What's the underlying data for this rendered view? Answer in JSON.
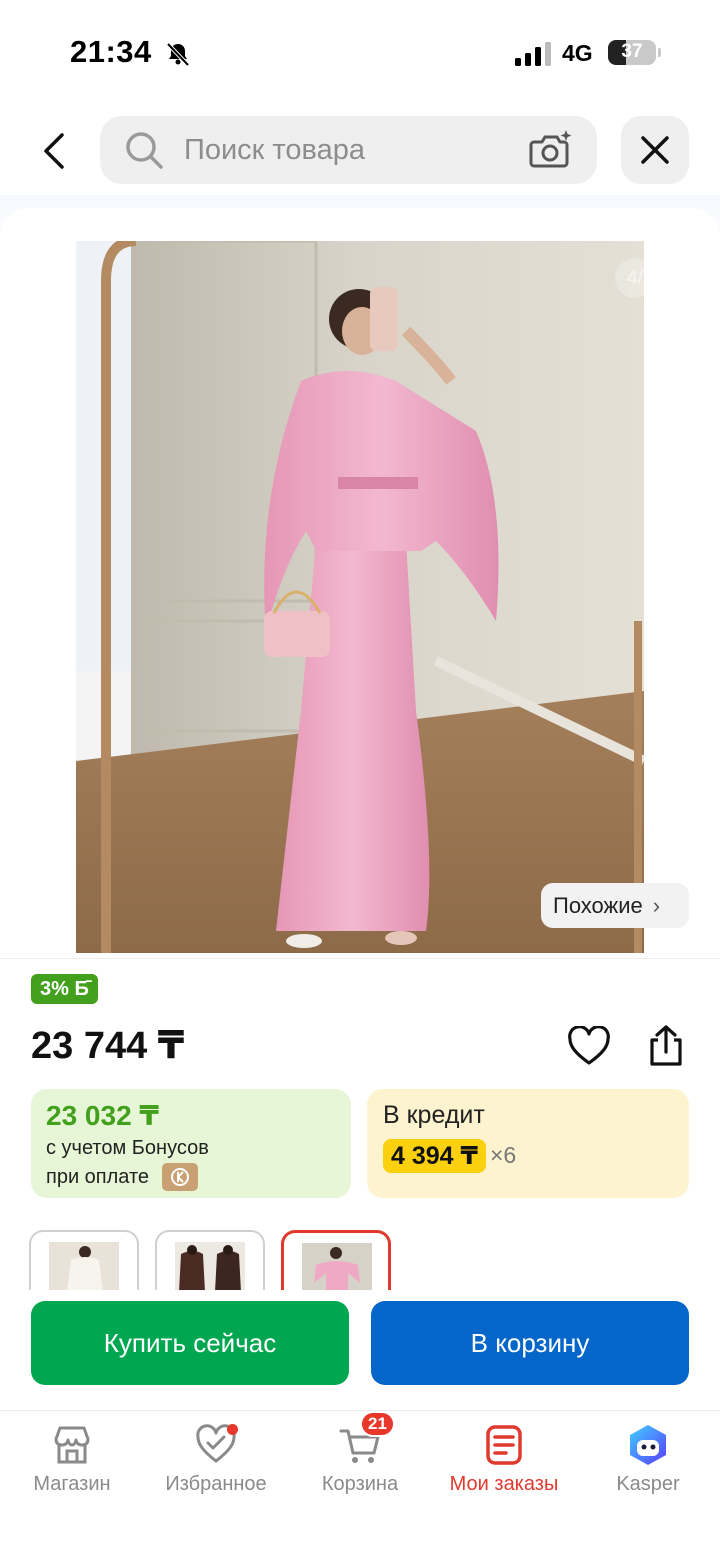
{
  "status_bar": {
    "time": "21:34",
    "network": "4G",
    "battery_level": "37"
  },
  "search": {
    "placeholder": "Поиск товара"
  },
  "product": {
    "image_counter": "4/",
    "similar_label": "Похожие",
    "bonus_badge": "3% Б̄",
    "price": "23 744 ₸",
    "bonus_price": "23 032 ₸",
    "bonus_line1": "с учетом Бонусов",
    "bonus_line2": "при оплате",
    "credit_title": "В кредит",
    "credit_amount": "4 394 ₸",
    "credit_multiplier": "×6",
    "thumbnails": [
      {
        "name": "white-outfit",
        "selected": false
      },
      {
        "name": "brown-outfit",
        "selected": false
      },
      {
        "name": "pink-outfit",
        "selected": true
      }
    ]
  },
  "actions": {
    "buy_now": "Купить сейчас",
    "add_to_cart": "В корзину"
  },
  "tabbar": {
    "items": [
      {
        "label": "Магазин",
        "icon": "store-icon",
        "active": false
      },
      {
        "label": "Избранное",
        "icon": "heart-icon",
        "active": false
      },
      {
        "label": "Корзина",
        "icon": "cart-icon",
        "active": false
      },
      {
        "label": "Мои заказы",
        "icon": "orders-icon",
        "active": true
      },
      {
        "label": "Kasper",
        "icon": "kasper-icon",
        "active": false
      }
    ],
    "cart_badge": "21"
  },
  "colors": {
    "accent_red": "#e0392e",
    "buy_green": "#00a650",
    "cart_blue": "#0466c8",
    "bonus_green": "#43a01c",
    "credit_yellow": "#fbd00f"
  }
}
